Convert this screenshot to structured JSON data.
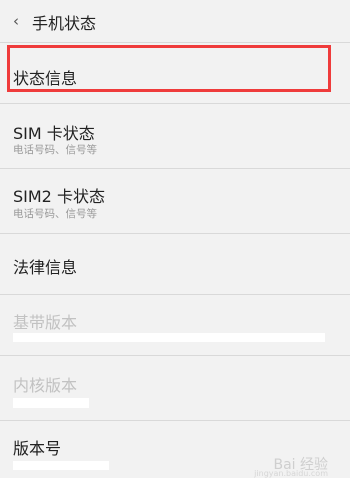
{
  "header": {
    "title": "手机状态",
    "back_icon": "‹"
  },
  "items": [
    {
      "label": "状态信息",
      "highlighted": true
    },
    {
      "label": "SIM 卡状态",
      "sub": "电话号码、信号等"
    },
    {
      "label": "SIM2 卡状态",
      "sub": "电话号码、信号等"
    },
    {
      "label": "法律信息"
    },
    {
      "label": "基带版本",
      "disabled": true
    },
    {
      "label": "内核版本",
      "disabled": true
    },
    {
      "label": "版本号"
    }
  ],
  "watermark": {
    "text": "Bai 经验",
    "sub": "jingyan.baidu.com"
  },
  "colors": {
    "highlight": "#ef3b3b",
    "background": "#f2f2f2",
    "divider": "#d9d9d9"
  }
}
